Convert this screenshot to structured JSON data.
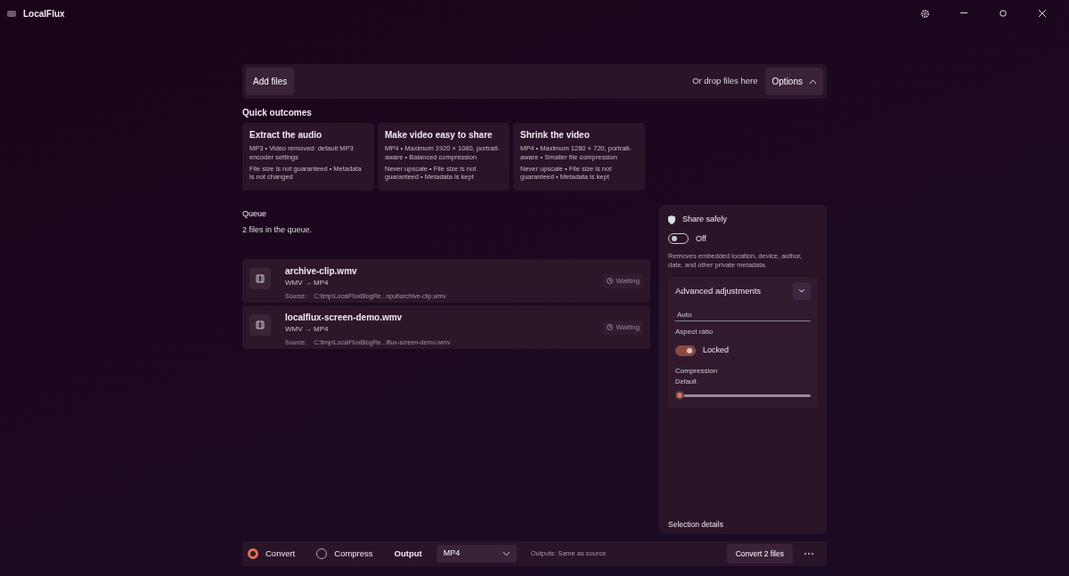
{
  "window": {
    "title": "LocalFlux"
  },
  "top_bar": {
    "add_button": "Add files",
    "drop_hint": "Or drop files here",
    "options_button": "Options",
    "options_expanded": true
  },
  "quick_outcomes": {
    "title": "Quick outcomes",
    "cards": [
      {
        "title": "Extract the audio",
        "details": "MP3 • Video removed: default MP3 encoder settings",
        "notes": "File size is not guaranteed • Metadata is not changed"
      },
      {
        "title": "Make video easy to share",
        "details": "MP4 • Maximum 1920 × 1080, portrait-aware • Balanced compression",
        "notes": "Never upscale • File size is not guaranteed • Metadata is kept"
      },
      {
        "title": "Shrink the video",
        "details": "MP4 • Maximum 1280 × 720, portrait-aware • Smaller file compression",
        "notes": "Never upscale • File size is not guaranteed • Metadata is kept"
      }
    ]
  },
  "queue": {
    "title": "Queue",
    "summary": "2 files in the queue.",
    "items": [
      {
        "name": "archive-clip.wmv",
        "conversion": "WMV → MP4",
        "source_label": "Source:",
        "source": "C:\\tmp\\LocalFluxBlogRe...nput\\archive-clip.wmv",
        "status": "Waiting"
      },
      {
        "name": "localflux-screen-demo.wmv",
        "conversion": "WMV → MP4",
        "source_label": "Source:",
        "source": "C:\\tmp\\LocalFluxBlogRe...lflux-screen-demo.wmv",
        "status": "Waiting"
      }
    ]
  },
  "side_panel": {
    "share_title": "Share safely",
    "share_on": false,
    "share_state": "Off",
    "share_description": "Removes embedded location, device, author, date, and other private metadata.",
    "advanced": {
      "title": "Advanced adjustments",
      "expanded": true,
      "size_value": "Auto",
      "aspect_label": "Aspect ratio",
      "aspect_locked": true,
      "aspect_state": "Locked",
      "compression": {
        "label": "Compression",
        "value": "Default",
        "level": 0
      }
    },
    "selection_title": "Selection details"
  },
  "bottom_bar": {
    "modes": [
      {
        "label": "Convert",
        "selected": true
      },
      {
        "label": "Compress",
        "selected": false
      }
    ],
    "output_label": "Output",
    "output_value": "MP4",
    "outputs_hint": "Outputs: Same as source",
    "convert_button": "Convert 2 files",
    "more_button": "⋯"
  }
}
